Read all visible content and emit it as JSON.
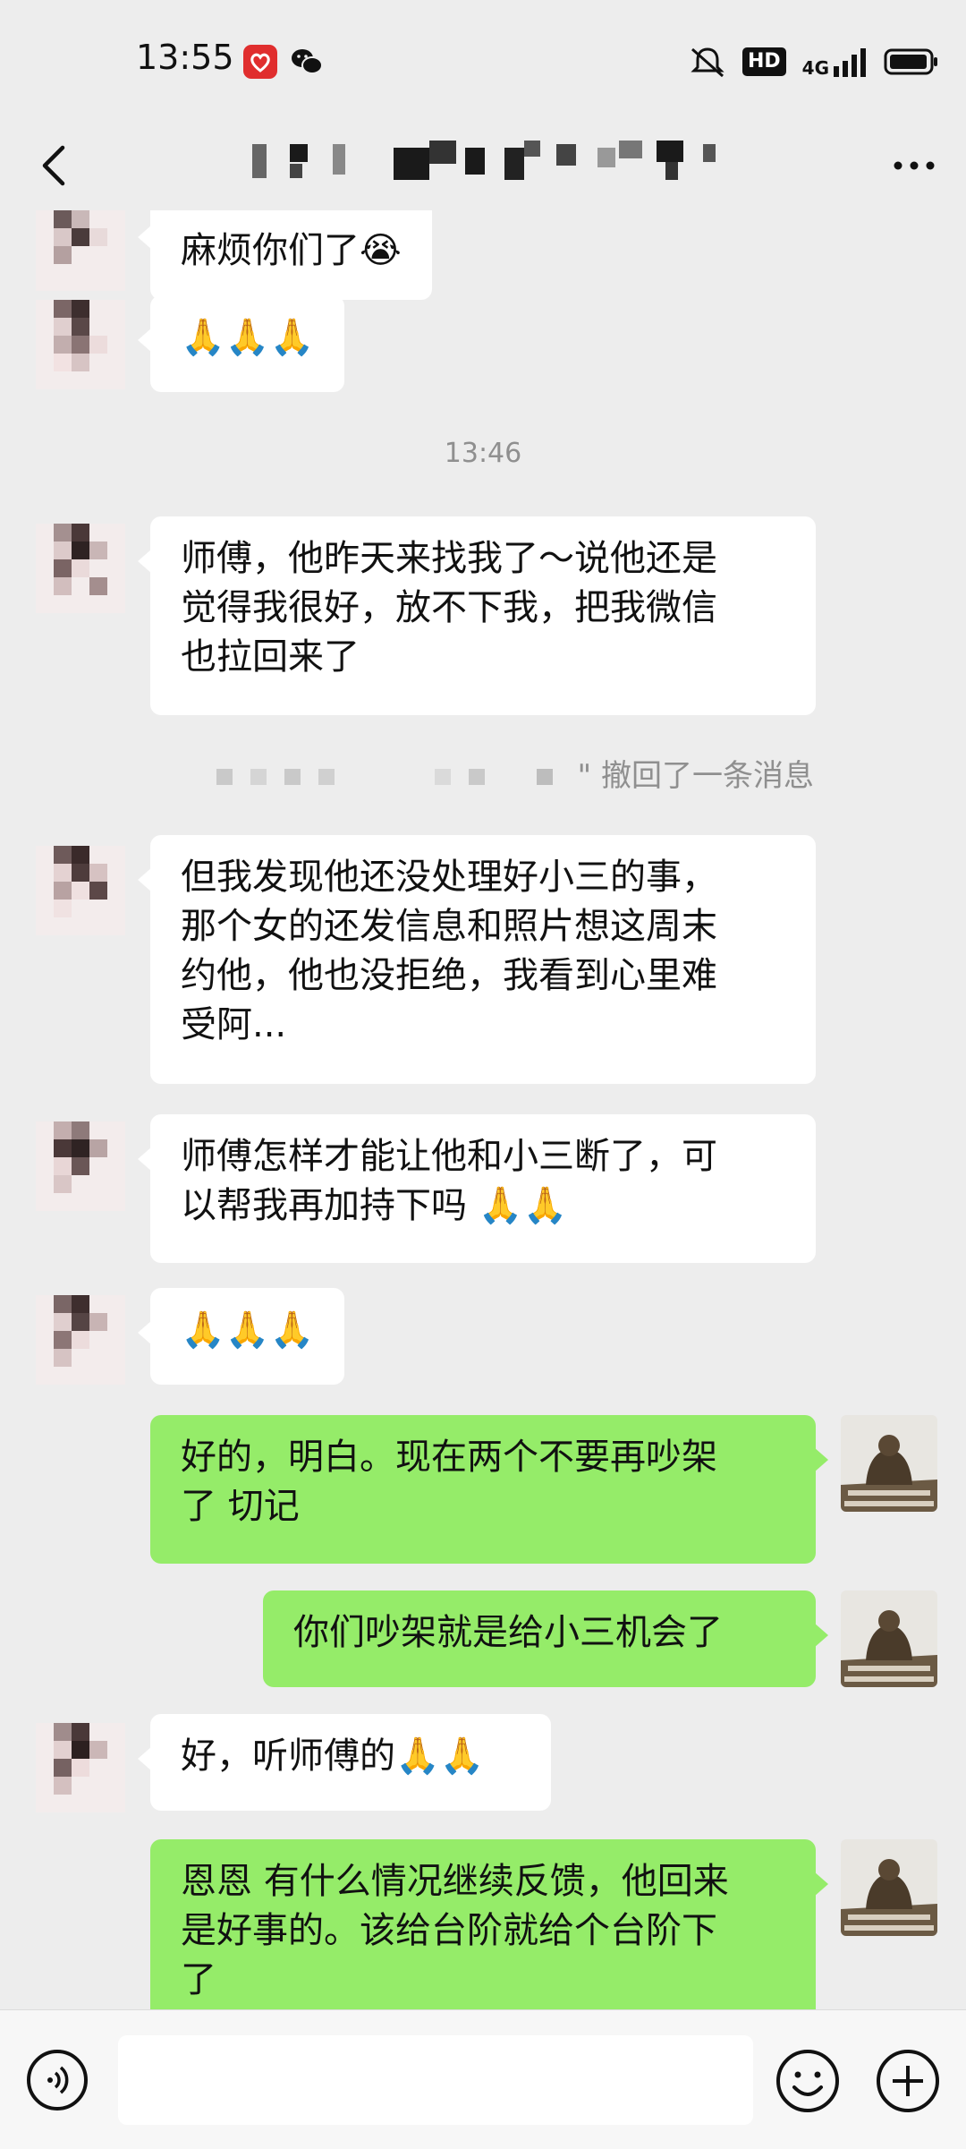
{
  "status_bar": {
    "time": "13:55",
    "hd": "HD",
    "network": "4G",
    "battery_level": 0.9
  },
  "header": {
    "title": ""
  },
  "messages": {
    "m1": {
      "text": "麻烦你们了😭"
    },
    "m2": {
      "text": "🙏🙏🙏"
    },
    "t1": {
      "text": "13:46"
    },
    "m3": {
      "text": "师傅，他昨天来找我了～说他还是\n觉得我很好，放不下我，把我微信\n也拉回来了"
    },
    "recall": {
      "text": "\" 撤回了一条消息"
    },
    "m4": {
      "text": "但我发现他还没处理好小三的事，\n那个女的还发信息和照片想这周末\n约他，他也没拒绝，我看到心里难\n受阿..."
    },
    "m5": {
      "text": "师傅怎样才能让他和小三断了，可\n以帮我再加持下吗 🙏🙏"
    },
    "m6": {
      "text": "🙏🙏🙏"
    },
    "m7": {
      "text": "好的，明白。现在两个不要再吵架\n了 切记"
    },
    "m8": {
      "text": "你们吵架就是给小三机会了"
    },
    "m9": {
      "text": "好，听师傅的🙏🙏"
    },
    "m10": {
      "text": "恩恩 有什么情况继续反馈，他回来\n是好事的。该给台阶就给个台阶下\n了"
    }
  },
  "input": {
    "value": "",
    "placeholder": ""
  },
  "icons": {
    "back": "chevron-left-icon",
    "more": "more-dots-icon",
    "voice": "voice-icon",
    "emoji": "emoji-icon",
    "plus": "plus-icon"
  },
  "colors": {
    "background": "#EDEDED",
    "incoming_bubble": "#FFFFFF",
    "outgoing_bubble": "#95EC69",
    "input_bar": "#F7F7F7"
  }
}
